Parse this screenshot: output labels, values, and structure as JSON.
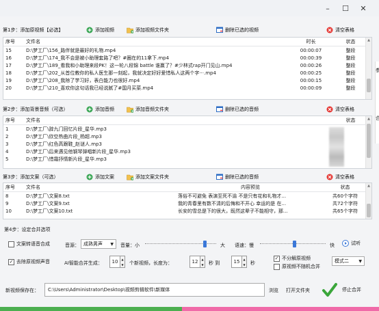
{
  "window": {
    "controls": [
      "–",
      "☐",
      "✕"
    ]
  },
  "step1": {
    "label": "第1步：添加原视频【必选】",
    "add_video": "添加视频",
    "add_folder": "添加视频文件夹",
    "delete_selected": "删除已选的视频",
    "clear_table": "清空表格",
    "columns": [
      "序号",
      "文件名",
      "时长",
      "状态"
    ],
    "rows": [
      [
        "15",
        "D:\\梦工厂\\156_路伴就是最好的礼物.mp4",
        "00:00:07",
        "整段"
      ],
      [
        "16",
        "D:\\梦工厂\\174_我不会是被小助理套路了吧？#圈在的11拿下.mp4",
        "00:00:39",
        "整段"
      ],
      [
        "17",
        "D:\\梦工厂\\189_看我和小助理来段PK！这一轮八段锦 battle 谁赢了？#少林式rap开门见山.mp4",
        "00:00:26",
        "整段"
      ],
      [
        "18",
        "D:\\梦工厂\\202_从首位教你的私人医生那一刻起，我就决定好好爱惜私人这两个字···.mp4",
        "00:00:25",
        "整段"
      ],
      [
        "19",
        "D:\\梦工厂\\208_我除了学习好，表白能力也很好.mp4",
        "00:00:15",
        "整段"
      ],
      [
        "20",
        "D:\\梦工厂\\210_喜欢你这句话我已经说腻了#国月买菜.mp4",
        "00:00:09",
        "整段"
      ]
    ]
  },
  "step2": {
    "label": "第2步：添加背景音频（可选）",
    "add_audio": "添加音频",
    "add_folder": "添加音频文件夹",
    "delete_selected": "删除已选的音频",
    "clear_table": "清空表格",
    "columns": [
      "序号",
      "文件名",
      "状态"
    ],
    "rows": [
      [
        "1",
        "D:\\梦工厂\\辞九门回忆片段_星华.mp3",
        ""
      ],
      [
        "2",
        "D:\\梦工厂\\欣空热曲片段_杨超.mp3",
        ""
      ],
      [
        "3",
        "D:\\梦工厂\\红色高跟鞋_赵谜人.mp3",
        ""
      ],
      [
        "4",
        "D:\\梦工厂\\后来遇见他钢琴弹唱新片段_星华.mp3",
        ""
      ],
      [
        "5",
        "D:\\梦工厂\\惜霜抒情新片段_星华.mp3",
        ""
      ]
    ]
  },
  "step3": {
    "label": "第3步：添加文案（可选）",
    "add_text": "添加文案",
    "add_folder": "添加文案文件夹",
    "delete_selected": "删除已选的音频",
    "clear_table": "清空表格",
    "columns": [
      "序号",
      "文件名",
      "内容预览",
      "状态"
    ],
    "rows": [
      [
        "8",
        "D:\\梦工厂\\文案8.txt",
        "落俗不可避免 表演至死不渝 不是只有花和礼物才...",
        "共60个字符"
      ],
      [
        "9",
        "D:\\梦工厂\\文案9.txt",
        "我的青春里有数不清的后悔和不开心 幸运的是 在...",
        "共72个字符"
      ],
      [
        "10",
        "D:\\梦工厂\\文案10.txt",
        "长安的雪总是下的很大，既然这辈子不能相守，那...",
        "共65个字符"
      ]
    ]
  },
  "step4": {
    "label": "第4步：设定合并选项",
    "tts_label": "文案转语音合成",
    "voice_label": "音源：",
    "voice_value": "成熟男声",
    "volume_label": "音量：小",
    "volume_max": "大",
    "volume_level": 0.86,
    "speed_label": "语速：慢",
    "speed_max": "快",
    "speed_level": 0.53,
    "trial_label": "试听",
    "remove_audio_label": "去除原视频声音",
    "ai_label": "AI智能合并生成：",
    "count_value": "10",
    "count_suffix": "个新视频，长度为：",
    "len_min": "12",
    "sec1": "秒 到",
    "len_max": "15",
    "sec2": "秒",
    "no_split_label": "不分解原视频",
    "no_random_label": "原视频不随机合并",
    "mode_value": "模式二"
  },
  "save": {
    "label": "新视频保存在：",
    "path": "C:\\Users\\Administrator\\Desktop\\视频剪辑软件\\新媒体",
    "browse": "浏览",
    "open_folder": "打开文件夹",
    "stop_label": "停止合并"
  },
  "side_peek": [
    "参",
    "合",
    "4"
  ],
  "colors": {
    "progress_left": "#4caf50",
    "progress_right": "#f06aa8",
    "accent_blue": "#3b78d8"
  }
}
